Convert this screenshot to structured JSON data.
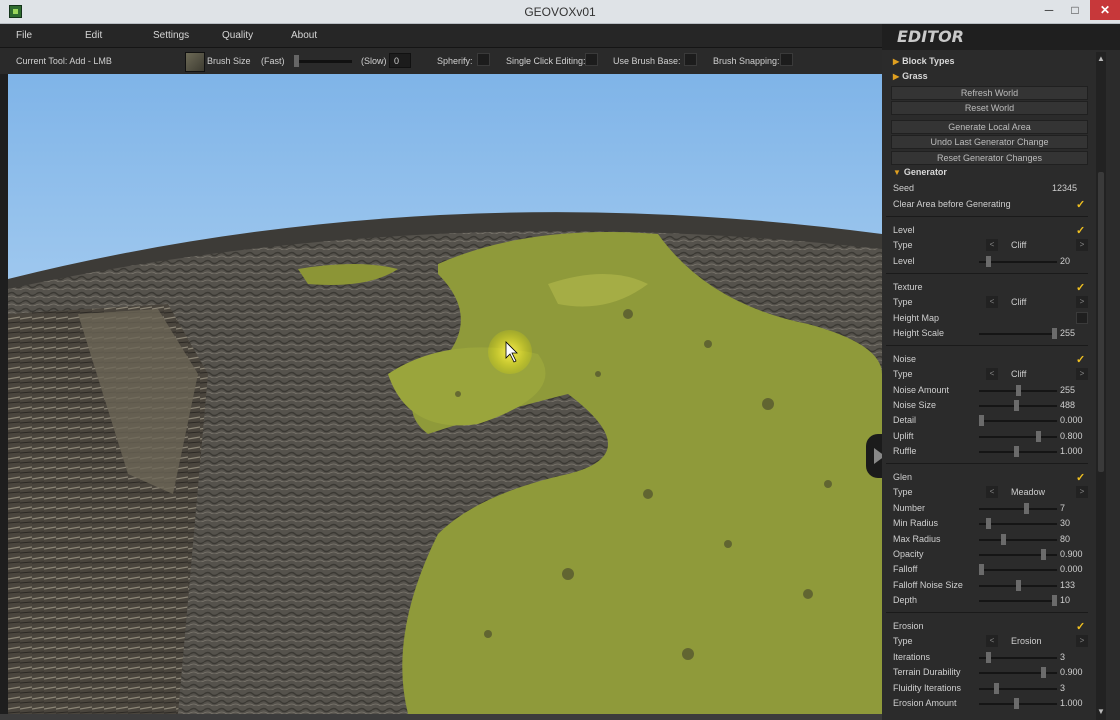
{
  "window": {
    "title": "GEOVOXv01",
    "min": "─",
    "max": "□",
    "close": "✕"
  },
  "menu": [
    "File",
    "Edit",
    "Settings",
    "Quality",
    "About"
  ],
  "toolbar": {
    "current_tool": "Current Tool: Add - LMB",
    "brush_size_label": "Brush Size",
    "fast": "(Fast)",
    "slow": "(Slow)",
    "brush_value": "0",
    "spherify": "Spherify:",
    "single_click": "Single Click Editing:",
    "brush_base": "Use Brush Base:",
    "brush_snapping": "Brush Snapping:"
  },
  "editor": {
    "title": "EDITOR",
    "block_types": "Block Types",
    "grass": "Grass",
    "buttons": {
      "refresh": "Refresh World",
      "reset": "Reset World",
      "generate": "Generate Local Area",
      "undo": "Undo Last Generator Change",
      "reset_gen": "Reset Generator Changes"
    },
    "generator": "Generator",
    "seed_label": "Seed",
    "seed_value": "12345",
    "clear_label": "Clear Area before Generating",
    "check": "✓",
    "left": "<",
    "right": ">",
    "level": {
      "title": "Level",
      "type_label": "Type",
      "type": "Cliff",
      "level_label": "Level",
      "level_value": "20",
      "level_fill": 0.1
    },
    "texture": {
      "title": "Texture",
      "type_label": "Type",
      "type": "Cliff",
      "height_map": "Height Map",
      "height_scale": "Height Scale",
      "height_scale_value": "255",
      "height_scale_fill": 1.0
    },
    "noise": {
      "title": "Noise",
      "type_label": "Type",
      "type": "Cliff",
      "rows": [
        {
          "label": "Noise Amount",
          "value": "255",
          "fill": 0.5
        },
        {
          "label": "Noise Size",
          "value": "488",
          "fill": 0.48
        },
        {
          "label": "Detail",
          "value": "0.000",
          "fill": 0.0
        },
        {
          "label": "Uplift",
          "value": "0.800",
          "fill": 0.78
        },
        {
          "label": "Ruffle",
          "value": "1.000",
          "fill": 0.48
        }
      ]
    },
    "glen": {
      "title": "Glen",
      "type_label": "Type",
      "type": "Meadow",
      "rows": [
        {
          "label": "Number",
          "value": "7",
          "fill": 0.62
        },
        {
          "label": "Min Radius",
          "value": "30",
          "fill": 0.1
        },
        {
          "label": "Max Radius",
          "value": "80",
          "fill": 0.3
        },
        {
          "label": "Opacity",
          "value": "0.900",
          "fill": 0.85
        },
        {
          "label": "Falloff",
          "value": "0.000",
          "fill": 0.0
        },
        {
          "label": "Falloff Noise Size",
          "value": "133",
          "fill": 0.5
        },
        {
          "label": "Depth",
          "value": "10",
          "fill": 1.0
        }
      ]
    },
    "erosion": {
      "title": "Erosion",
      "type_label": "Type",
      "type": "Erosion",
      "rows": [
        {
          "label": "Iterations",
          "value": "3",
          "fill": 0.1
        },
        {
          "label": "Terrain Durability",
          "value": "0.900",
          "fill": 0.85
        },
        {
          "label": "Fluidity Iterations",
          "value": "3",
          "fill": 0.2
        },
        {
          "label": "Erosion Amount",
          "value": "1.000",
          "fill": 0.48
        }
      ]
    }
  },
  "colors": {
    "grass": "#8f9a3a",
    "rock": "#5b5852",
    "sky_top": "#9cc8f0",
    "accent": "#f0c020"
  }
}
